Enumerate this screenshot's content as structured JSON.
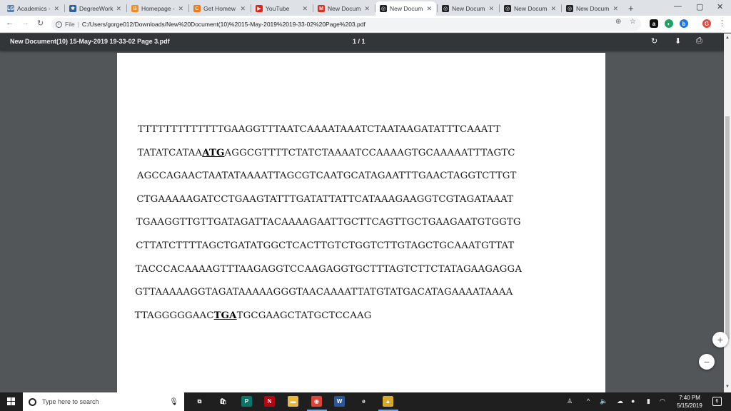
{
  "browser": {
    "tabs": [
      {
        "label": "Academics -",
        "icon_text": "LG",
        "icon_color": "#5b7fa8"
      },
      {
        "label": "DegreeWork",
        "icon_text": "✱",
        "icon_color": "#2d5ea3"
      },
      {
        "label": "Homepage -",
        "icon_text": "B",
        "icon_color": "#f08a24"
      },
      {
        "label": "Get Homew",
        "icon_text": "C",
        "icon_color": "#f07a1a"
      },
      {
        "label": "YouTube",
        "icon_text": "▶",
        "icon_color": "#e62117"
      },
      {
        "label": "New Docum",
        "icon_text": "M",
        "icon_color": "#d93025"
      },
      {
        "label": "New Docum",
        "icon_text": "◎",
        "icon_color": "#202124"
      },
      {
        "label": "New Docum",
        "icon_text": "◎",
        "icon_color": "#202124"
      },
      {
        "label": "New Docum",
        "icon_text": "◎",
        "icon_color": "#202124"
      },
      {
        "label": "New Docum",
        "icon_text": "◎",
        "icon_color": "#202124"
      }
    ],
    "active_tab_index": 6,
    "new_tab": "+",
    "address": {
      "scheme": "File",
      "url": "C:/Users/gorge012/Downloads/New%20Document(10)%2015-May-2019%2019-33-02%20Page%203.pdf"
    },
    "extensions": [
      {
        "label": "a",
        "color": "#111111"
      },
      {
        "label": "◐",
        "color": "#1aa260"
      },
      {
        "label": "b",
        "color": "#1a73e8"
      },
      {
        "label": "G",
        "color": "#e8453c"
      }
    ]
  },
  "pdf": {
    "title": "New Document(10) 15-May-2019 19-33-02 Page 3.pdf",
    "page_indicator": "1 / 1",
    "zoom_in": "+",
    "zoom_out": "−"
  },
  "sequence": {
    "lines": [
      {
        "pre": "TTTTTTTTTTTTTGAAGGTTTAATCAAAATAAATCTAATAAGATATTTCAAATT",
        "codon": "",
        "post": ""
      },
      {
        "pre": "TATATCATAA",
        "codon": "ATG",
        "post": "AGGCGTTTTCTATCTAAAATCCAAAAGTGCAAAAATTTAGTC"
      },
      {
        "pre": "AGCCAGAACTAATATAAAATTAGCGTCAATGCATAGAATTTGAACTAGGTCTTGT",
        "codon": "",
        "post": ""
      },
      {
        "pre": "CTGAAAAAGATCCTGAAGTATTTGATATTATTCATAAAGAAGGTCGTAGATAAAT",
        "codon": "",
        "post": ""
      },
      {
        "pre": "TGAAGGTTGTTGATAGATTACAAAAGAATTGCTTCAGTTGCTGAAGAATGTGGTG",
        "codon": "",
        "post": ""
      },
      {
        "pre": "CTTATCTTTTAGCTGATATGGCTCACTTGTCTGGTCTTGTAGCTGCAAATGTTAT",
        "codon": "",
        "post": ""
      },
      {
        "pre": "TACCCACAAAAGTTTAAGAGGTCCAAGAGGTGCTTTAGTCTTCTATAGAAGAGGA",
        "codon": "",
        "post": ""
      },
      {
        "pre": "GTTAAAAAGGTAGATAAAAAGGGTAACAAAATTATGTATGACATAGAAAATAAAA",
        "codon": "",
        "post": ""
      },
      {
        "pre": "TTAGGGGGAAC",
        "codon": "TGA",
        "post": "TGCGAAGCTATGCTCCAAG"
      }
    ]
  },
  "taskbar": {
    "search_placeholder": "Type here to search",
    "apps": [
      {
        "name": "task-view",
        "label": "⧉",
        "color": "#1f1f1f"
      },
      {
        "name": "store",
        "label": "🛍",
        "color": "#1f1f1f"
      },
      {
        "name": "publisher",
        "label": "P",
        "color": "#077568"
      },
      {
        "name": "netflix",
        "label": "N",
        "color": "#b20710"
      },
      {
        "name": "file-explorer",
        "label": "▬",
        "color": "#e8b93a"
      },
      {
        "name": "chrome",
        "label": "◉",
        "color": "#db4437"
      },
      {
        "name": "word",
        "label": "W",
        "color": "#2b579a"
      },
      {
        "name": "edge",
        "label": "e",
        "color": "#1f1f1f"
      },
      {
        "name": "photos",
        "label": "▲",
        "color": "#d9a92a"
      }
    ],
    "time": "7:40 PM",
    "date": "5/15/2019",
    "notifications": "6"
  }
}
